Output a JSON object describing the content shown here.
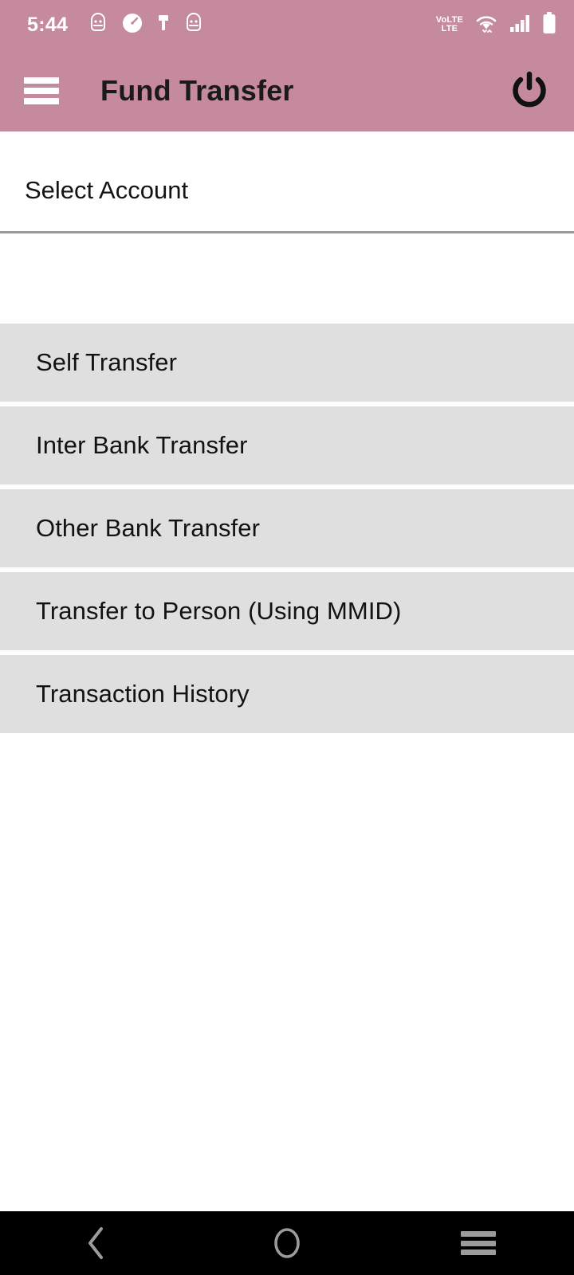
{
  "status_bar": {
    "time": "5:44",
    "left_icons": [
      "app-notification-icon",
      "speedometer-icon",
      "paintbrush-icon",
      "app-notification-icon"
    ],
    "volte_top": "VoLTE",
    "volte_line1": "VoLTE",
    "volte_line2": "LTE",
    "right_icons": [
      "volte-icon",
      "wifi-icon",
      "cellular-signal-icon",
      "battery-icon"
    ],
    "background_color": "#c68a9f",
    "foreground_color": "#ffffff"
  },
  "app_bar": {
    "menu_icon": "hamburger-menu-icon",
    "title": "Fund Transfer",
    "action_icon": "power-icon",
    "background_color": "#c68a9f",
    "title_color": "#1a1a1a"
  },
  "main": {
    "select_account_label": "Select Account",
    "menu_items": [
      {
        "label": "Self Transfer"
      },
      {
        "label": "Inter Bank Transfer"
      },
      {
        "label": "Other Bank Transfer"
      },
      {
        "label": "Transfer to Person (Using MMID)"
      },
      {
        "label": "Transaction History"
      }
    ],
    "item_background_color": "#dfdfdf",
    "divider_color": "#9a9a9a"
  },
  "nav_bar": {
    "back_icon": "back-chevron-icon",
    "home_icon": "home-circle-icon",
    "recents_icon": "recents-icon",
    "background_color": "#000000",
    "icon_color": "#9b9b9b"
  }
}
